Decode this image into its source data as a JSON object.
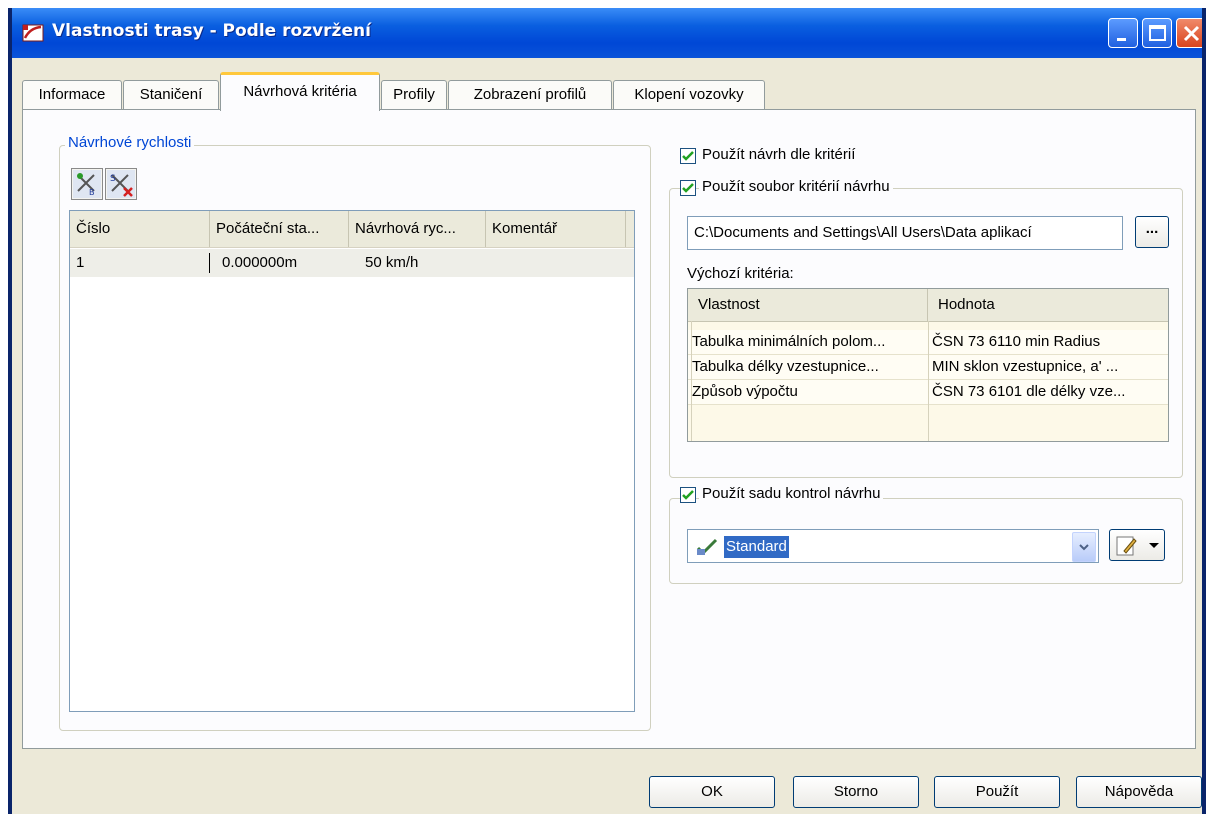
{
  "window": {
    "title": "Vlastnosti trasy - Podle rozvržení",
    "title_icon": "alignment-icon",
    "controls": {
      "minimize": "minimize-icon",
      "maximize": "maximize-icon",
      "close": "close-icon"
    }
  },
  "tabs": [
    {
      "label": "Informace",
      "active": false
    },
    {
      "label": "Staničení",
      "active": false
    },
    {
      "label": "Návrhová kritéria",
      "active": true
    },
    {
      "label": "Profily",
      "active": false
    },
    {
      "label": "Zobrazení profilů",
      "active": false
    },
    {
      "label": "Klopení vozovky",
      "active": false
    }
  ],
  "speeds": {
    "group_label": "Návrhové rychlosti",
    "toolbar": {
      "add_icon": "add-speed-icon",
      "delete_icon": "delete-speed-icon"
    },
    "columns": [
      "Číslo",
      "Počáteční sta...",
      "Návrhová ryc...",
      "Komentář"
    ],
    "rows": [
      {
        "number": "1",
        "start": "0.000000m",
        "speed": "50 km/h",
        "comment": ""
      }
    ]
  },
  "criteria": {
    "use_design_label": "Použít návrh dle kritérií",
    "use_design_checked": true,
    "use_file_label": "Použít soubor kritérií návrhu",
    "use_file_checked": true,
    "file_path": "C:\\Documents and Settings\\All Users\\Data aplikací",
    "browse_label": "...",
    "default_label": "Výchozí kritéria:",
    "grid_columns": [
      "Vlastnost",
      "Hodnota"
    ],
    "grid_rows": [
      {
        "property": "Tabulka minimálních polom...",
        "value": "ČSN 73 6110 min Radius"
      },
      {
        "property": "Tabulka délky vzestupnice...",
        "value": "MIN sklon vzestupnice, a' ..."
      },
      {
        "property": "Způsob výpočtu",
        "value": "ČSN 73 6101 dle délky vze..."
      }
    ]
  },
  "checks": {
    "use_checkset_label": "Použít sadu kontrol návrhu",
    "use_checkset_checked": true,
    "selected": "Standard",
    "item_icon": "check-set-icon",
    "edit_icon": "edit-icon"
  },
  "buttons": {
    "ok": "OK",
    "cancel": "Storno",
    "apply": "Použít",
    "help": "Nápověda"
  }
}
